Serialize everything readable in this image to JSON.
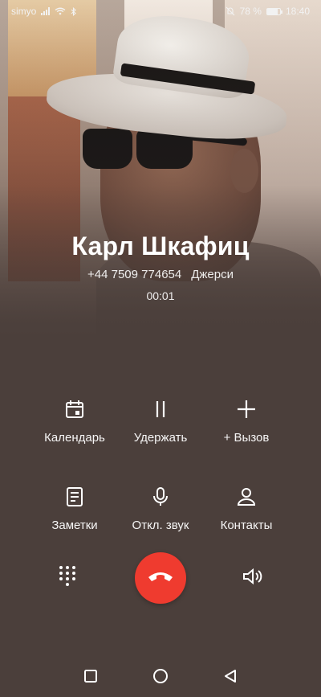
{
  "status_bar": {
    "carrier": "simyo",
    "battery_percent": "78 %",
    "time": "18:40",
    "icons": [
      "signal-icon",
      "wifi-icon",
      "bluetooth-icon",
      "mute-icon",
      "battery-icon"
    ]
  },
  "caller": {
    "name": "Карл Шкафиц",
    "phone": "+44 7509 774654",
    "location": "Джерси",
    "duration": "00:01"
  },
  "actions": {
    "calendar": "Календарь",
    "hold": "Удержать",
    "add_call": "+ Вызов",
    "notes": "Заметки",
    "mute": "Откл. звук",
    "contacts": "Контакты"
  },
  "colors": {
    "background": "#4b3f3b",
    "end_call": "#ef3b2f",
    "text": "#ffffff"
  }
}
